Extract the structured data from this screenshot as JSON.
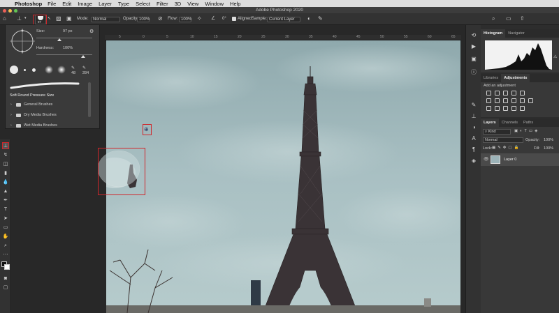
{
  "menubar": {
    "items": [
      "Photoshop",
      "File",
      "Edit",
      "Image",
      "Layer",
      "Type",
      "Select",
      "Filter",
      "3D",
      "View",
      "Window",
      "Help"
    ]
  },
  "titlebar": {
    "title": "Adobe Photoshop 2020"
  },
  "options": {
    "brush_size": "97",
    "mode_label": "Mode:",
    "mode_value": "Normal",
    "opacity_label": "Opacity:",
    "opacity_value": "100%",
    "flow_label": "Flow:",
    "flow_value": "100%",
    "aligned_label": "Aligned",
    "sample_label": "Sample:",
    "sample_value": "Current Layer"
  },
  "brush_popup": {
    "size_label": "Size:",
    "size_value": "97 px",
    "hardness_label": "Hardness:",
    "hardness_value": "100%",
    "preset_sizes": [
      "48",
      "284"
    ],
    "selected_brush": "Soft Round Pressure Size",
    "folders": [
      "General Brushes",
      "Dry Media Brushes",
      "Wet Media Brushes"
    ]
  },
  "ruler": {
    "ticks": [
      "5",
      "0",
      "5",
      "10",
      "15",
      "20",
      "25",
      "30",
      "35",
      "40",
      "45",
      "50",
      "55",
      "60",
      "65"
    ]
  },
  "panels": {
    "histogram": {
      "tabs": [
        "Histogram",
        "Navigator"
      ]
    },
    "adjustments": {
      "tabs": [
        "Libraries",
        "Adjustments"
      ],
      "add_label": "Add an adjustment"
    },
    "layers": {
      "tabs": [
        "Layers",
        "Channels",
        "Paths"
      ],
      "filter_label": "Kind",
      "blend_mode": "Normal",
      "opacity_label": "Opacity:",
      "opacity_value": "100%",
      "lock_label": "Lock:",
      "fill_label": "Fill:",
      "fill_value": "100%",
      "layer_name": "Layer 0"
    }
  },
  "colors": {
    "highlight": "#d0262b",
    "sky": "#9cb3b8",
    "panel": "#383838"
  }
}
